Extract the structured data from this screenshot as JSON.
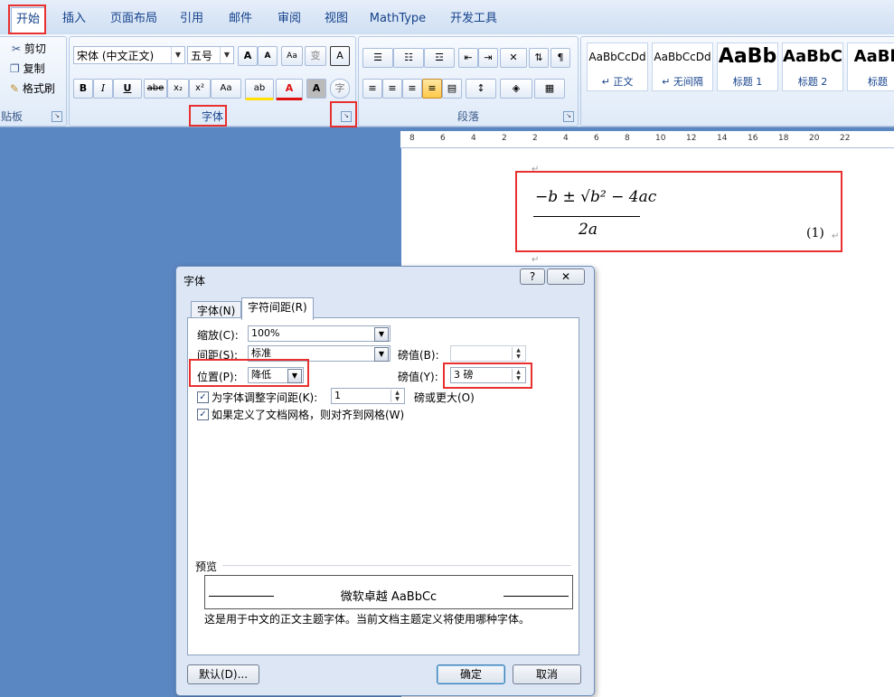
{
  "tabs": [
    "开始",
    "插入",
    "页面布局",
    "引用",
    "邮件",
    "审阅",
    "视图",
    "MathType",
    "开发工具"
  ],
  "clipboard": {
    "cut": "剪切",
    "copy": "复制",
    "format_painter": "格式刷",
    "label": "贴板"
  },
  "font_group": {
    "font_name": "宋体 (中文正文)",
    "font_size": "五号",
    "label": "字体",
    "grow": "A",
    "shrink": "A",
    "clear": "Aa",
    "phonetic": "变",
    "border_char": "A",
    "bold": "B",
    "italic": "I",
    "underline": "U",
    "strike": "abe",
    "sub": "x₂",
    "sup": "x²",
    "case": "Aa",
    "highlight": "ab",
    "color": "A",
    "shade": "A",
    "enclose": "字"
  },
  "paragraph_group": {
    "label": "段落"
  },
  "styles": [
    {
      "sample": "AaBbCcDd",
      "name": "↵ 正文"
    },
    {
      "sample": "AaBbCcDd",
      "name": "↵ 无间隔"
    },
    {
      "sample": "AaBb",
      "name": "标题 1"
    },
    {
      "sample": "AaBbC",
      "name": "标题 2"
    },
    {
      "sample": "AaBb",
      "name": "标题"
    }
  ],
  "ruler_ticks": [
    "8",
    "6",
    "4",
    "2",
    "2",
    "4",
    "6",
    "8",
    "10",
    "12",
    "14",
    "16",
    "18",
    "20",
    "22"
  ],
  "equation": {
    "numerator": "−b ± √b² − 4ac",
    "denominator": "2a",
    "number": "(1)"
  },
  "dialog": {
    "title": "字体",
    "help": "?",
    "close": "✕",
    "tabs": [
      "字体(N)",
      "字符间距(R)"
    ],
    "scale_label": "缩放(C):",
    "scale_value": "100%",
    "spacing_label": "间距(S):",
    "spacing_value": "标准",
    "spacing_pt_label": "磅值(B):",
    "spacing_pt_value": "",
    "position_label": "位置(P):",
    "position_value": "降低",
    "position_pt_label": "磅值(Y):",
    "position_pt_value": "3 磅",
    "kerning_label": "为字体调整字间距(K):",
    "kerning_value": "1",
    "kerning_suffix": "磅或更大(O)",
    "grid_label": "如果定义了文档网格，则对齐到网格(W)",
    "preview_label": "预览",
    "preview_text": "微软卓越 AaBbCc",
    "preview_note": "这是用于中文的正文主题字体。当前文档主题定义将使用哪种字体。",
    "default_button": "默认(D)...",
    "ok_button": "确定",
    "cancel_button": "取消"
  }
}
